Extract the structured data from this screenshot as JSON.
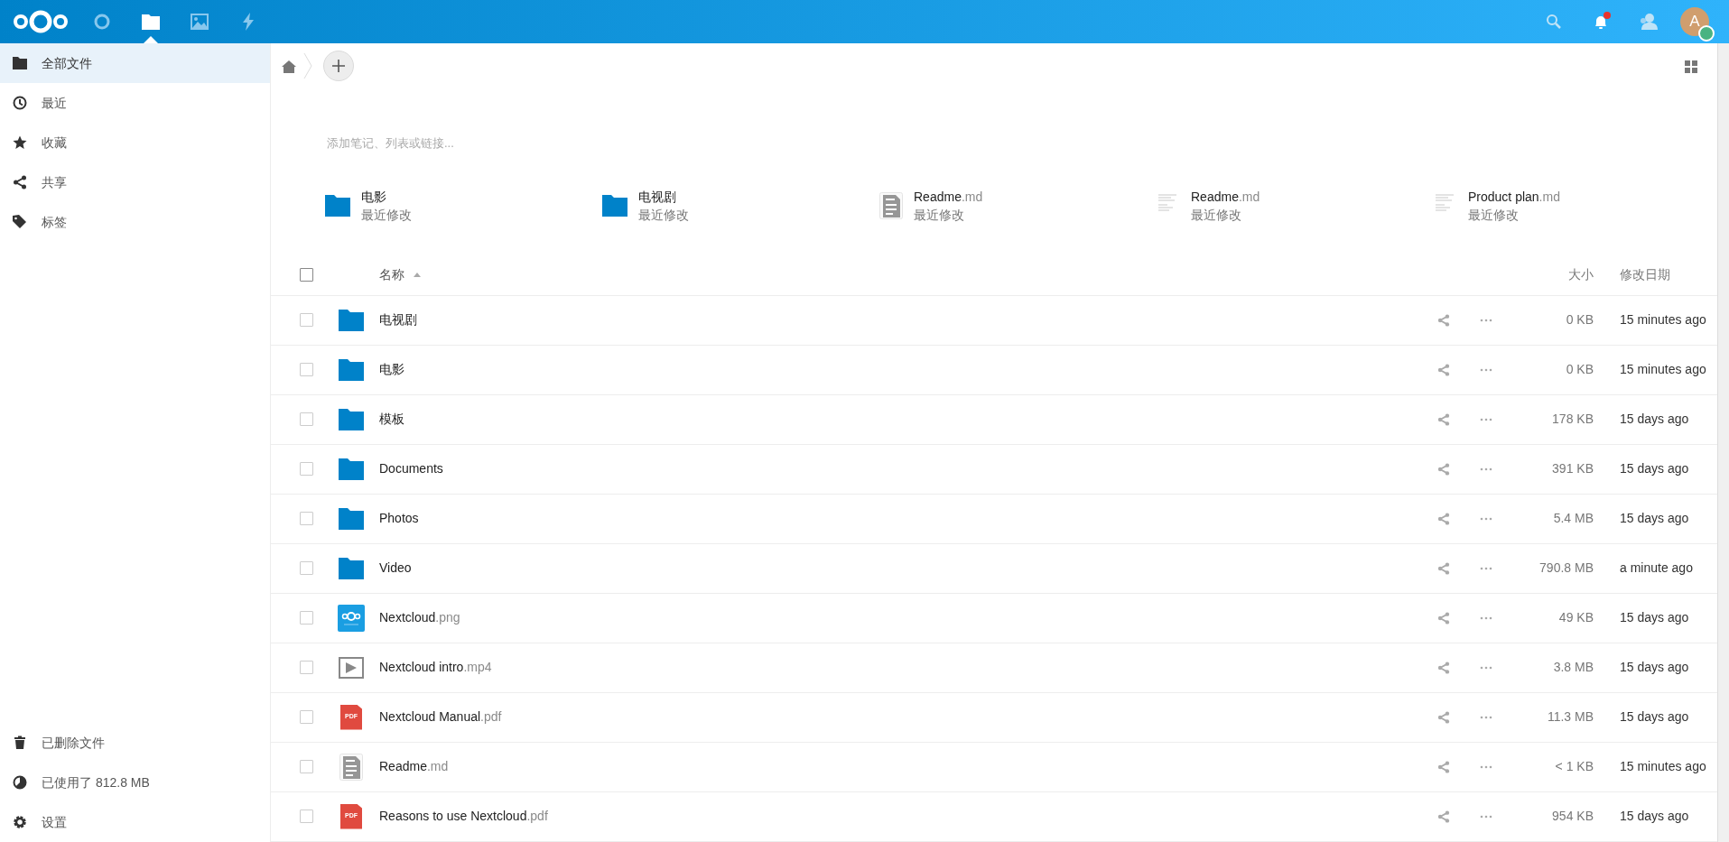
{
  "header": {
    "apps": [
      {
        "kind": "dashboard",
        "selected": false
      },
      {
        "kind": "files",
        "selected": true
      },
      {
        "kind": "photos",
        "selected": false
      },
      {
        "kind": "activity",
        "selected": false
      }
    ],
    "notifications": {
      "unread": true
    },
    "avatar": {
      "initial": "A",
      "status_dot": {
        "color": "#49b382"
      }
    }
  },
  "sidebar": {
    "items": [
      {
        "kind": "folder",
        "label": "全部文件",
        "selected": true
      },
      {
        "kind": "clock",
        "label": "最近",
        "selected": false
      },
      {
        "kind": "star",
        "label": "收藏",
        "selected": false
      },
      {
        "kind": "share",
        "label": "共享",
        "selected": false
      },
      {
        "kind": "tag",
        "label": "标签",
        "selected": false
      }
    ],
    "footer": [
      {
        "kind": "trash",
        "label": "已删除文件"
      },
      {
        "kind": "quota",
        "label": "已使用了 812.8 MB"
      },
      {
        "kind": "gear",
        "label": "设置"
      }
    ]
  },
  "notes": {
    "placeholder": "添加笔记、列表或链接..."
  },
  "recent": [
    {
      "kind": "folder",
      "name": "电影",
      "caption": "最近修改"
    },
    {
      "kind": "folder",
      "name": "电视剧",
      "caption": "最近修改"
    },
    {
      "kind": "text",
      "name": "Readme",
      "ext": ".md",
      "caption": "最近修改"
    },
    {
      "kind": "preview",
      "name": "Readme",
      "ext": ".md",
      "caption": "最近修改"
    },
    {
      "kind": "preview",
      "name": "Product plan",
      "ext": ".md",
      "caption": "最近修改"
    }
  ],
  "table": {
    "select_all": {
      "checked": false
    },
    "columns": [
      {
        "label": "名称",
        "sorted": true,
        "ascending": true
      },
      {
        "label": "大小",
        "sorted": false
      },
      {
        "label": "修改日期",
        "sorted": false
      }
    ],
    "rows": [
      {
        "kind": "folder",
        "name": "电视剧",
        "size": "0 KB",
        "modified": "15 minutes ago",
        "checked": false
      },
      {
        "kind": "folder",
        "name": "电影",
        "size": "0 KB",
        "modified": "15 minutes ago",
        "checked": false
      },
      {
        "kind": "folder",
        "name": "模板",
        "size": "178 KB",
        "modified": "15 days ago",
        "checked": false
      },
      {
        "kind": "folder",
        "name": "Documents",
        "size": "391 KB",
        "modified": "15 days ago",
        "checked": false
      },
      {
        "kind": "folder",
        "name": "Photos",
        "size": "5.4 MB",
        "modified": "15 days ago",
        "checked": false
      },
      {
        "kind": "folder",
        "name": "Video",
        "size": "790.8 MB",
        "modified": "a minute ago",
        "checked": false
      },
      {
        "kind": "image",
        "name": "Nextcloud",
        "ext": ".png",
        "size": "49 KB",
        "modified": "15 days ago",
        "checked": false
      },
      {
        "kind": "video",
        "name": "Nextcloud intro",
        "ext": ".mp4",
        "size": "3.8 MB",
        "modified": "15 days ago",
        "checked": false
      },
      {
        "kind": "pdf",
        "icon_text": "PDF",
        "name": "Nextcloud Manual",
        "ext": ".pdf",
        "size": "11.3 MB",
        "modified": "15 days ago",
        "checked": false
      },
      {
        "kind": "text",
        "name": "Readme",
        "ext": ".md",
        "size": "< 1 KB",
        "modified": "15 minutes ago",
        "checked": false
      },
      {
        "kind": "pdf",
        "icon_text": "PDF",
        "name": "Reasons to use Nextcloud",
        "ext": ".pdf",
        "size": "954 KB",
        "modified": "15 days ago",
        "checked": false
      }
    ]
  }
}
